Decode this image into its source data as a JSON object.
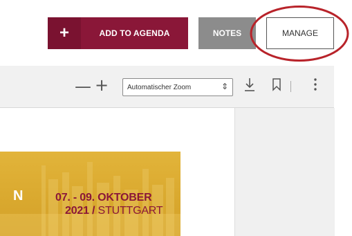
{
  "actions": {
    "add_icon": "+",
    "add_label": "ADD TO AGENDA",
    "notes_label": "NOTES",
    "manage_label": "MANAGE"
  },
  "viewer": {
    "zoom_out_icon": "—",
    "zoom_in_icon": "+",
    "zoom_value": "Automatischer Zoom",
    "chevron": "⌃⌄",
    "more_icon": "⋮"
  },
  "banner": {
    "partial_text": "N",
    "date_line": "07. - 09. OKTOBER",
    "year": "2021 /",
    "city": " STUTTGART"
  },
  "colors": {
    "accent": "#8a1738",
    "notes_bg": "#8c8c8c",
    "highlight": "#c0262d",
    "banner_bg": "#dcac33"
  }
}
